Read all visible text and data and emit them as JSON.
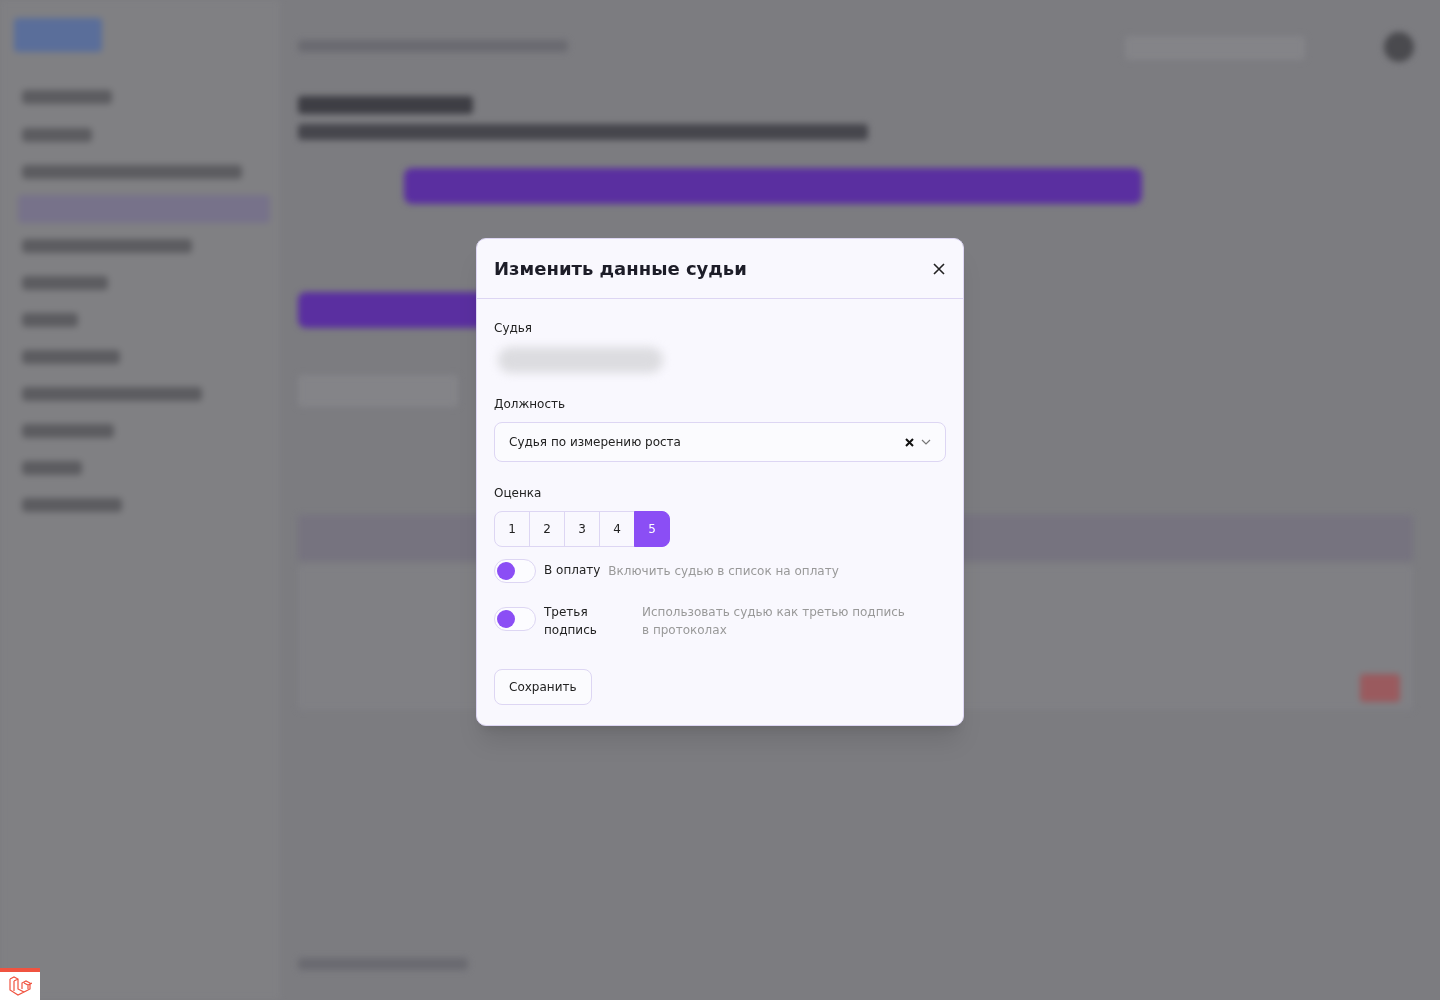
{
  "dialog": {
    "title": "Изменить данные судьи",
    "judge": {
      "label": "Судья"
    },
    "position": {
      "label": "Должность",
      "value": "Судья по измерению роста"
    },
    "rating": {
      "label": "Оценка",
      "options": [
        {
          "label": "1",
          "selected": false
        },
        {
          "label": "2",
          "selected": false
        },
        {
          "label": "3",
          "selected": false
        },
        {
          "label": "4",
          "selected": false
        },
        {
          "label": "5",
          "selected": true
        }
      ]
    },
    "toggles": [
      {
        "label": "В оплату",
        "hint": "Включить судью в список на оплату",
        "on": false
      },
      {
        "label": "Третья подпись",
        "hint": "Использовать судью как третью подпись в протоколах",
        "on": false
      }
    ],
    "save_button": "Сохранить"
  }
}
